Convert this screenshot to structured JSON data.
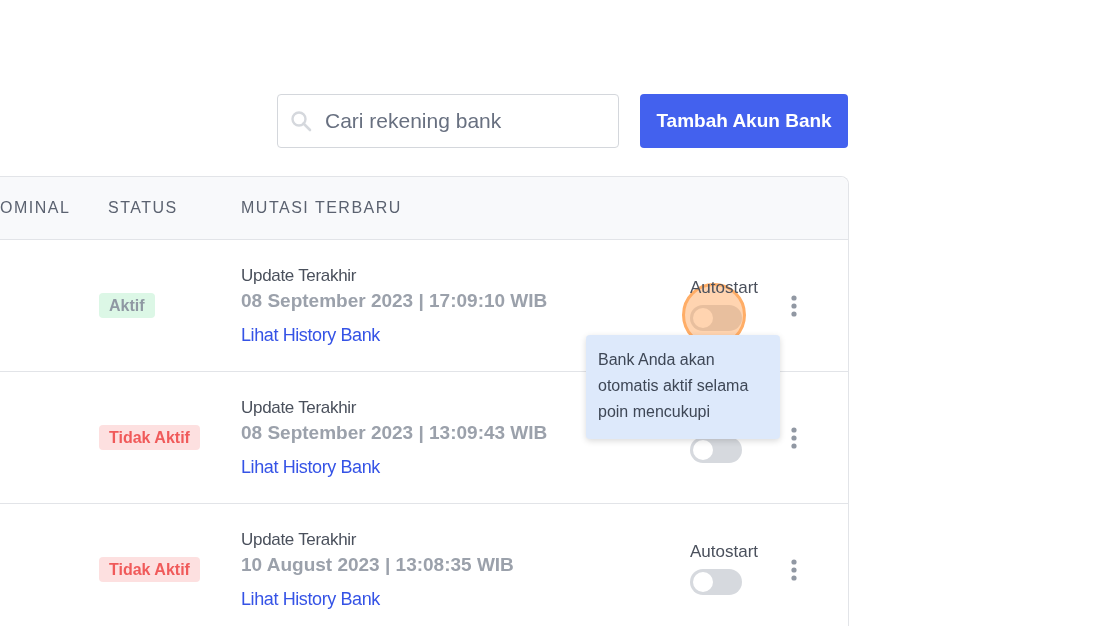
{
  "search": {
    "placeholder": "Cari rekening bank"
  },
  "add_button": {
    "label": "Tambah Akun Bank"
  },
  "table": {
    "columns": [
      "OMINAL",
      "STATUS",
      "MUTASI TERBARU"
    ],
    "rows": [
      {
        "status": {
          "label": "Aktif",
          "active": true
        },
        "update_label": "Update Terakhir",
        "update_time": "08 September 2023 | 17:09:10 WIB",
        "link": "Lihat History Bank",
        "autostart_label": "Autostart",
        "autostart_on": false,
        "highlighted": true
      },
      {
        "status": {
          "label": "Tidak Aktif",
          "active": false
        },
        "update_label": "Update Terakhir",
        "update_time": "08 September 2023 | 13:09:43 WIB",
        "link": "Lihat History Bank",
        "autostart_on": false,
        "highlighted": false
      },
      {
        "status": {
          "label": "Tidak Aktif",
          "active": false
        },
        "update_label": "Update Terakhir",
        "update_time": "10 August 2023 | 13:08:35 WIB",
        "link": "Lihat History Bank",
        "autostart_label": "Autostart",
        "autostart_on": false,
        "highlighted": false
      }
    ]
  },
  "tooltip": {
    "text": "Bank Anda akan otomatis aktif selama poin mencukupi"
  }
}
